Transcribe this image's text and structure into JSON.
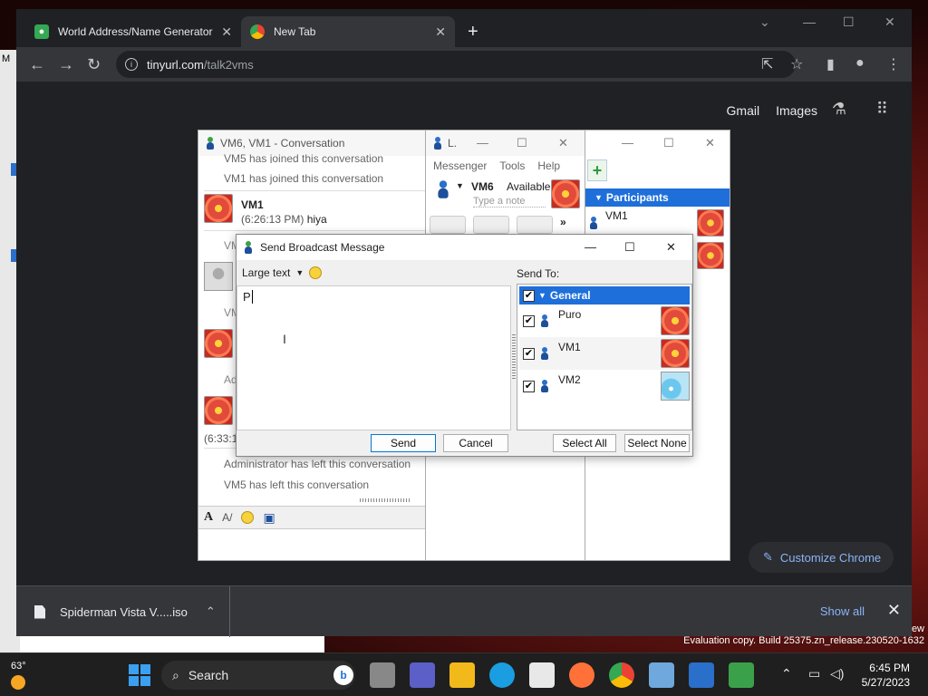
{
  "desktop": {
    "left_letter": "M",
    "watermark_line1": "ew",
    "watermark_line2": "Evaluation copy. Build 25375.zn_release.230520-1632"
  },
  "chrome": {
    "tabs": [
      {
        "title": "World Address/Name Generator",
        "active": false
      },
      {
        "title": "New Tab",
        "active": true
      }
    ],
    "url_host": "tinyurl.com",
    "url_path": "/talk2vms",
    "ntp_links": [
      "Gmail",
      "Images"
    ],
    "customize_label": "Customize Chrome",
    "download": {
      "filename": "Spiderman Vista V.....iso",
      "show_all": "Show all"
    }
  },
  "conversation": {
    "title": "VM6, VM1 - Conversation",
    "system_messages": [
      "VM5 has joined this conversation",
      "VM1 has joined this conversation"
    ],
    "message": {
      "sender": "VM1",
      "timestamp": "(6:26:13 PM)",
      "text": "hiya"
    },
    "partial_1": "VM",
    "partial_2": "VM",
    "partial_3": "Ad",
    "partial_ts": "(6:33:1",
    "leave_messages": [
      "Administrator has left this conversation",
      "VM5 has left this conversation"
    ]
  },
  "contact_list": {
    "title": "L.",
    "menu": [
      "Messenger",
      "Tools",
      "Help"
    ],
    "name": "VM6",
    "status": "Available",
    "note_placeholder": "Type a note",
    "more": "»"
  },
  "participants": {
    "header": "Participants",
    "items": [
      "VM1"
    ]
  },
  "broadcast": {
    "title": "Send Broadcast Message",
    "font_option": "Large text",
    "message_text": "P",
    "send_to_label": "Send To:",
    "group": "General",
    "recipients": [
      {
        "name": "Puro",
        "checked": true
      },
      {
        "name": "VM1",
        "checked": true
      },
      {
        "name": "VM2",
        "checked": true
      }
    ],
    "send_label": "Send",
    "cancel_label": "Cancel",
    "select_all_label": "Select All",
    "select_none_label": "Select None"
  },
  "taskbar": {
    "temperature": "63°",
    "search_label": "Search",
    "time": "6:45 PM",
    "date": "5/27/2023"
  }
}
